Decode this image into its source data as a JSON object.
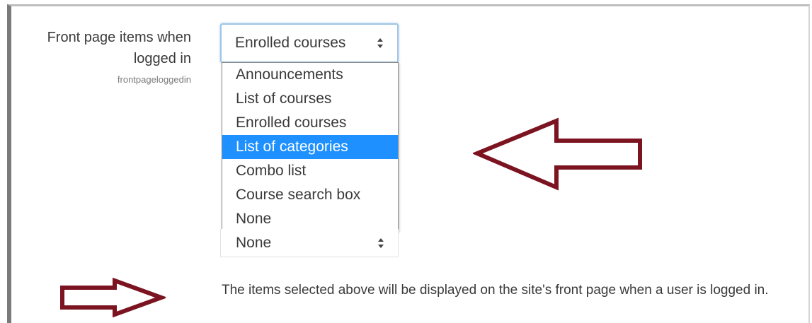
{
  "setting": {
    "label": "Front page items when logged in",
    "key": "frontpageloggedin"
  },
  "select_top": {
    "value": "Enrolled courses"
  },
  "dropdown": {
    "options": [
      "Announcements",
      "List of courses",
      "Enrolled courses",
      "List of categories",
      "Combo list",
      "Course search box",
      "None"
    ],
    "highlighted": "List of categories"
  },
  "select_bottom": {
    "value": "None"
  },
  "description": "The items selected above will be displayed on the site's front page when a user is logged in.",
  "colors": {
    "arrow": "#7b1420",
    "highlight": "#1e90ff",
    "focus_border": "#9ec6e6"
  },
  "icons": [
    "sort-caret-icon",
    "left-arrow-annotation",
    "right-arrow-annotation"
  ]
}
